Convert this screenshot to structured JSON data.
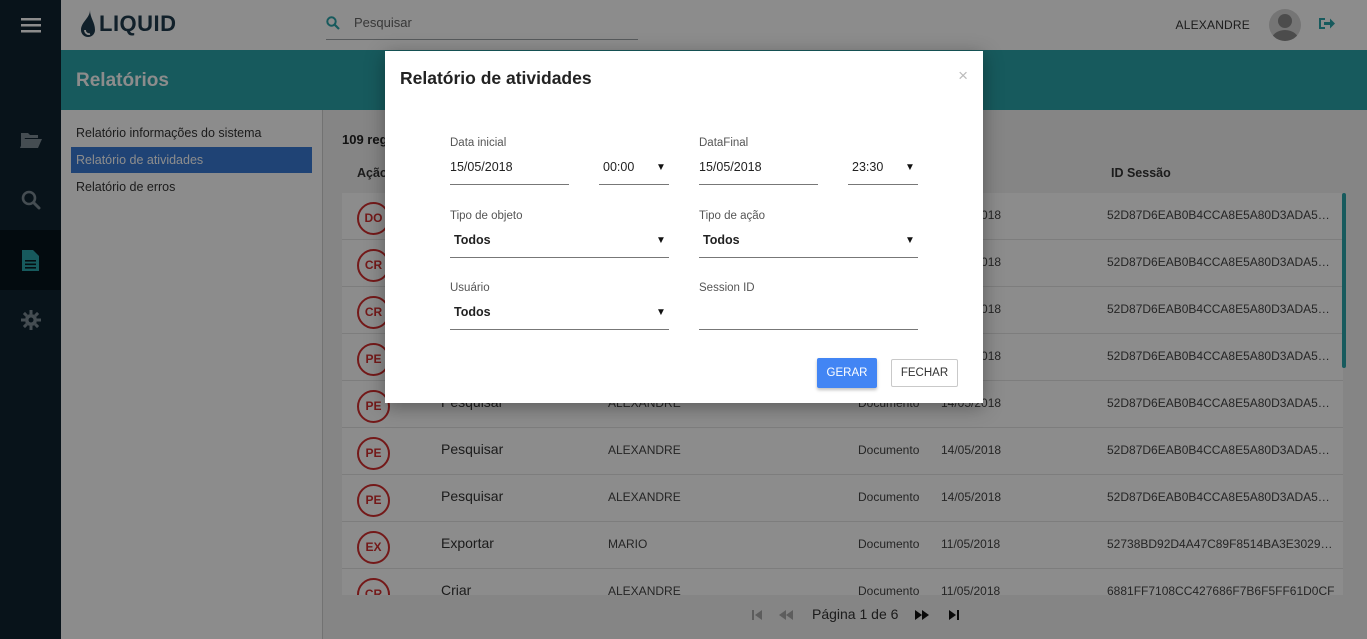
{
  "app": {
    "logo_text": "LIQUID",
    "user_name": "ALEXANDRE"
  },
  "search": {
    "placeholder": "Pesquisar"
  },
  "page": {
    "title": "Relatórios"
  },
  "sidebar": {
    "items": [
      {
        "label": "Relatório informações do sistema",
        "active": false
      },
      {
        "label": "Relatório de atividades",
        "active": true
      },
      {
        "label": "Relatório de erros",
        "active": false
      }
    ]
  },
  "rail": {
    "icons": [
      "menu-icon",
      "folder-open-icon",
      "search-icon",
      "document-icon",
      "gear-icon"
    ]
  },
  "main": {
    "count_text": "109 reg",
    "headers": {
      "acao": "Ação",
      "sessao": "ID Sessão"
    },
    "rows": [
      {
        "badge": "DO",
        "acao": "",
        "user": "",
        "obj": "",
        "date": "14/05/2018",
        "session": "52D87D6EAB0B4CCA8E5A80D3ADA5CD..."
      },
      {
        "badge": "CR",
        "acao": "",
        "user": "",
        "obj": "",
        "date": "14/05/2018",
        "session": "52D87D6EAB0B4CCA8E5A80D3ADA5CD..."
      },
      {
        "badge": "CR",
        "acao": "",
        "user": "",
        "obj": "",
        "date": "14/05/2018",
        "session": "52D87D6EAB0B4CCA8E5A80D3ADA5CD..."
      },
      {
        "badge": "PE",
        "acao": "",
        "user": "",
        "obj": "",
        "date": "14/05/2018",
        "session": "52D87D6EAB0B4CCA8E5A80D3ADA5CD..."
      },
      {
        "badge": "PE",
        "acao": "Pesquisar",
        "user": "ALEXANDRE",
        "obj": "Documento",
        "date": "14/05/2018",
        "session": "52D87D6EAB0B4CCA8E5A80D3ADA5CD..."
      },
      {
        "badge": "PE",
        "acao": "Pesquisar",
        "user": "ALEXANDRE",
        "obj": "Documento",
        "date": "14/05/2018",
        "session": "52D87D6EAB0B4CCA8E5A80D3ADA5CD..."
      },
      {
        "badge": "PE",
        "acao": "Pesquisar",
        "user": "ALEXANDRE",
        "obj": "Documento",
        "date": "14/05/2018",
        "session": "52D87D6EAB0B4CCA8E5A80D3ADA5CD..."
      },
      {
        "badge": "EX",
        "acao": "Exportar",
        "user": "MARIO",
        "obj": "Documento",
        "date": "11/05/2018",
        "session": "52738BD92D4A47C89F8514BA3E3029A7"
      },
      {
        "badge": "CR",
        "acao": "Criar",
        "user": "ALEXANDRE",
        "obj": "Documento",
        "date": "11/05/2018",
        "session": "6881FF7108CC427686F7B6F5FF61D0CF"
      }
    ],
    "pager": {
      "text": "Página 1 de 6"
    }
  },
  "modal": {
    "title": "Relatório de atividades",
    "close": "×",
    "data_inicial": {
      "label": "Data inicial",
      "date": "15/05/2018",
      "time": "00:00"
    },
    "data_final": {
      "label": "DataFinal",
      "date": "15/05/2018",
      "time": "23:30"
    },
    "tipo_objeto": {
      "label": "Tipo de objeto",
      "value": "Todos"
    },
    "tipo_acao": {
      "label": "Tipo de ação",
      "value": "Todos"
    },
    "usuario": {
      "label": "Usuário",
      "value": "Todos"
    },
    "session_id": {
      "label": "Session ID",
      "value": ""
    },
    "gerar_label": "GERAR",
    "fechar_label": "FECHAR",
    "caret": "▼"
  },
  "colors": {
    "rail": "#0f2330",
    "accent": "#2aa5a9",
    "primary": "#4285f4",
    "badge": "#d32f2f",
    "active_item": "#3a7bd5"
  }
}
